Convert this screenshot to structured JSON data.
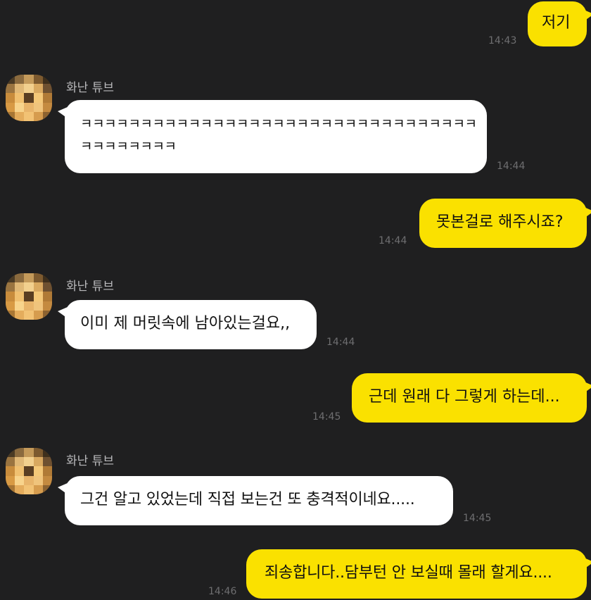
{
  "chat": {
    "sender_name": "화난 튜브",
    "messages": [
      {
        "from": "me",
        "text": "저기",
        "time": "14:43"
      },
      {
        "from": "them",
        "text_line1": "ㅋㅋㅋㅋㅋㅋㅋㅋㅋㅋㅋㅋㅋㅋㅋㅋㅋㅋㅋㅋㅋㅋㅋㅋㅋㅋㅋㅋㅋㅋㅋㅋㅋ",
        "text_line2": "ㅋㅋㅋㅋㅋㅋㅋㅋ",
        "time": "14:44"
      },
      {
        "from": "me",
        "text": "못본걸로 해주시죠?",
        "time": "14:44"
      },
      {
        "from": "them",
        "text": "이미 제 머릿속에 남아있는걸요,,",
        "time": "14:44"
      },
      {
        "from": "me",
        "text": "근데 원래 다 그렇게 하는데...",
        "time": "14:45"
      },
      {
        "from": "them",
        "text": "그건 알고 있었는데 직접 보는건 또 충격적이네요.....",
        "time": "14:45"
      },
      {
        "from": "me",
        "text": "죄송합니다..담부턴 안 보실때 몰래 할게요....",
        "time": "14:46"
      }
    ]
  },
  "colors": {
    "background": "#1f1f20",
    "my_bubble": "#fae100",
    "their_bubble": "#ffffff",
    "timestamp": "#6e6e70",
    "sender_name": "#b9b9bb"
  }
}
